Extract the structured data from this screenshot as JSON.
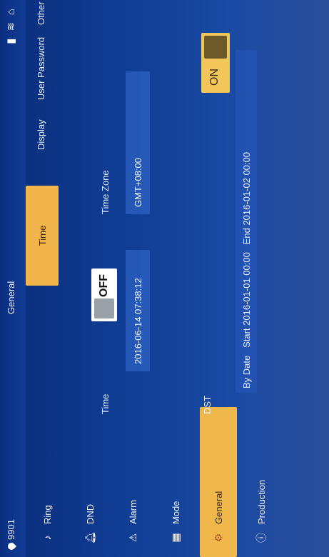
{
  "header": {
    "room_number": "9901",
    "title": "General",
    "icons": [
      "sd-card-icon",
      "wifi-icon",
      "home-icon"
    ]
  },
  "sidebar": {
    "items": [
      {
        "label": "Ring",
        "icon": "music-note-icon"
      },
      {
        "label": "DND",
        "icon": "bell-icon"
      },
      {
        "label": "Alarm",
        "icon": "alarm-icon"
      },
      {
        "label": "Mode",
        "icon": "grid-icon"
      },
      {
        "label": "General",
        "icon": "gear-icon",
        "active": true
      },
      {
        "label": "Production",
        "icon": "info-icon"
      }
    ]
  },
  "tabs": [
    {
      "label": "Time",
      "active": true
    },
    {
      "label": "Display"
    },
    {
      "label": "User Password"
    },
    {
      "label": "Other"
    }
  ],
  "time_section": {
    "time_label": "Time",
    "time_value": "2016-06-14 07:38:12",
    "auto_toggle": "OFF",
    "timezone_label": "Time Zone",
    "timezone_value": "GMT+08:00"
  },
  "dst_section": {
    "dst_label": "DST",
    "dst_toggle": "ON",
    "mode": "By Date",
    "start_label": "Start",
    "start_value": "2016-01-01 00:00",
    "end_label": "End",
    "end_value": "2016-01-02 00:00"
  },
  "colors": {
    "accent": "#f1b54b",
    "background": "#0f3c93",
    "field": "#376ed2"
  }
}
